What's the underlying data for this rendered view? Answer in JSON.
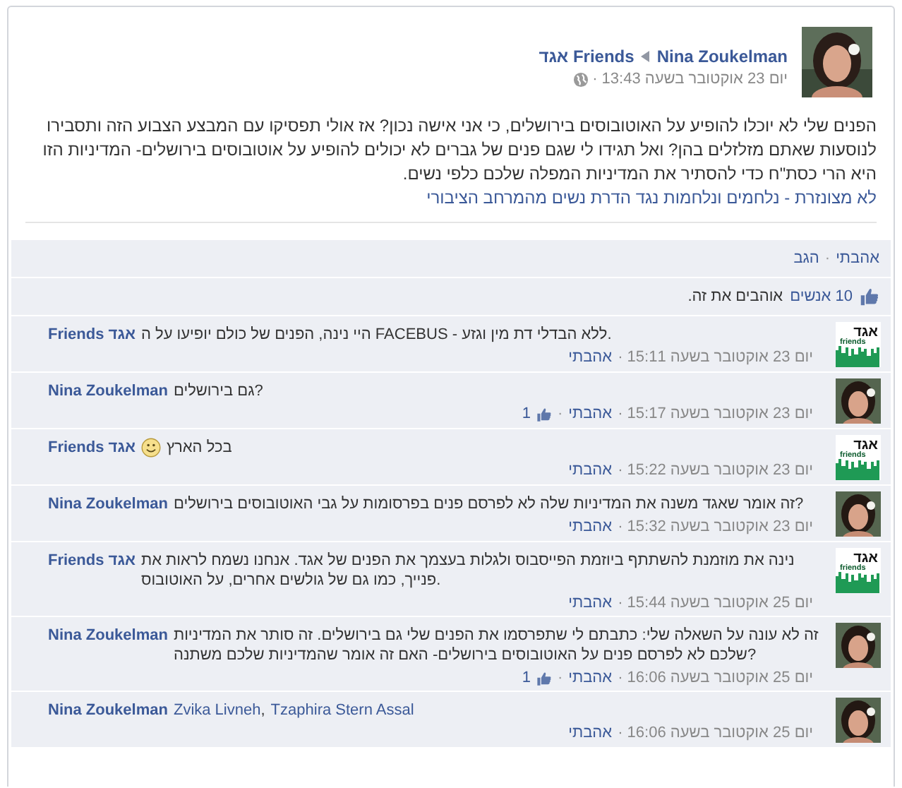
{
  "post": {
    "author": "Nina Zoukelman",
    "target": "Friends אגד",
    "time": "יום 23 אוקטובר בשעה 13:43 ·",
    "text": "הפנים שלי לא יוכלו להופיע על האוטובוסים בירושלים, כי אני אישה נכון? אז אולי תפסיקו עם המבצע הצבוע הזה ותסבירו לנוסעות שאתם מזלזלים בהן? ואל תגידו לי שגם פנים של גברים לא יכולים להופיע על אוטובוסים בירושלים- המדיניות הזו היא הרי כסת\"ח כדי להסתיר את המדיניות המפלה שלכם כלפי נשים.",
    "link": "לא מצונזרת - נלחמים ונלחמות נגד הדרת נשים מהמרחב הציבורי"
  },
  "actions": {
    "like": "אהבתי",
    "separator": "·",
    "comment": "הגב"
  },
  "likes": {
    "count": "10 אנשים",
    "text": "אוהבים את זה."
  },
  "comments": [
    {
      "author": "Friends אגד",
      "avatar": {
        "kind": "logo",
        "text": "אגד",
        "subtext": "friends"
      },
      "text": "היי נינה, הפנים של כולם יופיעו על ה FACEBUS - ללא הבדלי דת מין וגזע.",
      "time": "יום 23 אוקטובר בשעה 15:11 ·",
      "like": "אהבתי"
    },
    {
      "author": "Nina Zoukelman",
      "text": "גם בירושלים?",
      "time": "יום 23 אוקטובר בשעה 15:17 ·",
      "like": "אהבתי",
      "like_count": "1"
    },
    {
      "author": "Friends אגד",
      "avatar": {
        "kind": "logo",
        "text": "אגד",
        "subtext": "friends"
      },
      "smiley": true,
      "text": "בכל הארץ",
      "time": "יום 23 אוקטובר בשעה 15:22 ·",
      "like": "אהבתי"
    },
    {
      "author": "Nina Zoukelman",
      "text": "זה אומר שאגד משנה את המדיניות שלה לא לפרסם פנים בפרסומות על גבי האוטובוסים בירושלים?",
      "time": "יום 23 אוקטובר בשעה 15:32 ·",
      "like": "אהבתי"
    },
    {
      "author": "Friends אגד",
      "avatar": {
        "kind": "logo",
        "text": "אגד",
        "subtext": "friends"
      },
      "text": "נינה את מוזמנת להשתתף ביוזמת הפייסבוס ולגלות בעצמך את הפנים של אגד. אנחנו נשמח לראות את פנייך, כמו גם של גולשים אחרים, על האוטובוס.",
      "time": "יום 25 אוקטובר בשעה 15:44 ·",
      "like": "אהבתי"
    },
    {
      "author": "Nina Zoukelman",
      "text": "זה לא עונה על השאלה שלי: כתבתם לי שתפרסמו את הפנים שלי גם בירושלים. זה סותר את המדיניות שלכם לא לפרסם פנים על האוטובוסים בירושלים- האם זה אומר שהמדיניות שלכם משתנה?",
      "time": "יום 25 אוקטובר בשעה 16:06 ·",
      "like": "אהבתי",
      "like_count": "1"
    },
    {
      "author": "Nina Zoukelman",
      "tags": [
        "Tzaphira Stern Assal",
        "Zvika Livneh"
      ],
      "tag_separator": ",",
      "time": "יום 25 אוקטובר בשעה 16:06 ·",
      "like": "אהבתי"
    }
  ]
}
